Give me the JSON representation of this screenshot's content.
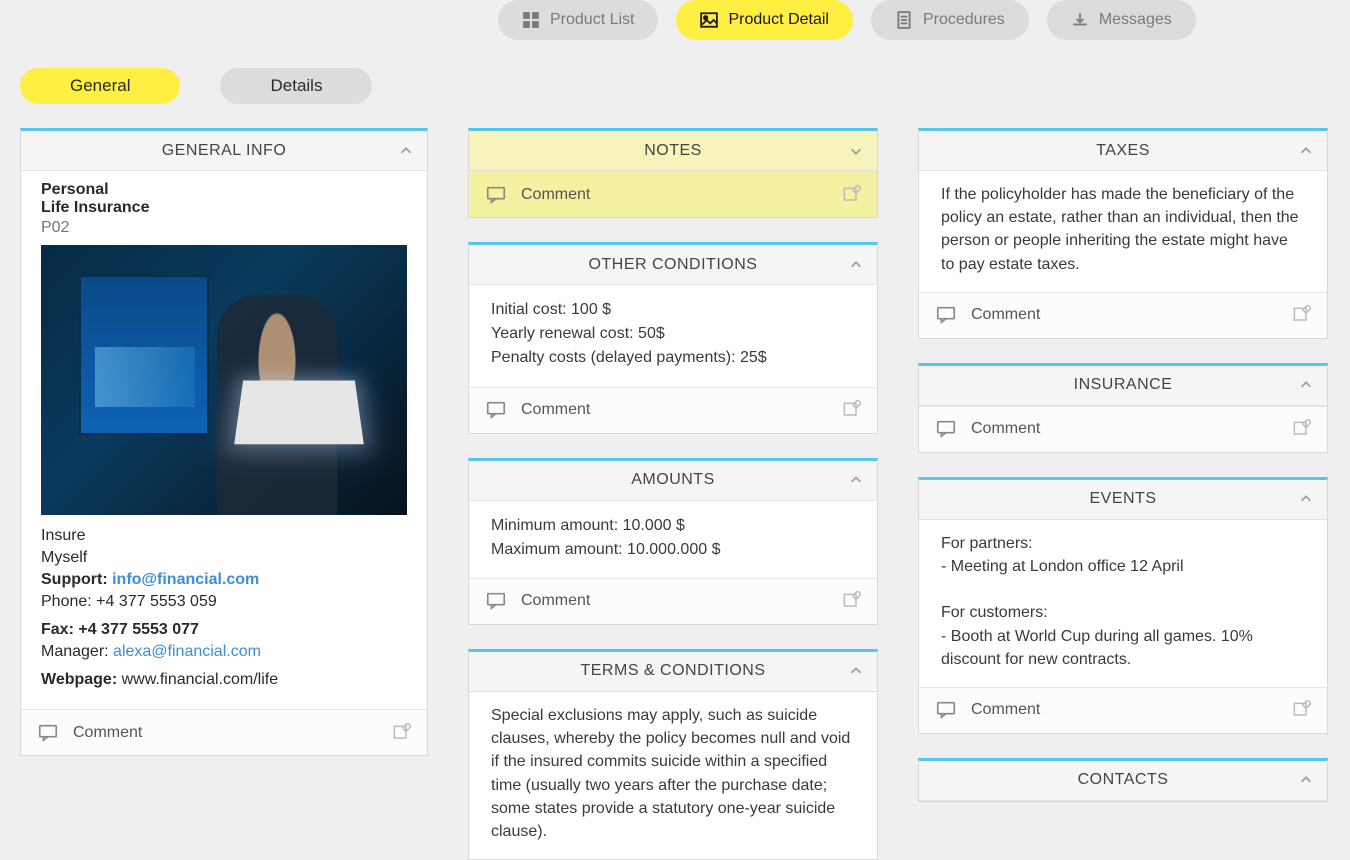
{
  "top_tabs": [
    {
      "id": "product-list",
      "label": "Product List",
      "icon": "grid",
      "active": false
    },
    {
      "id": "product-detail",
      "label": "Product Detail",
      "icon": "image",
      "active": true
    },
    {
      "id": "procedures",
      "label": "Procedures",
      "icon": "document",
      "active": false
    },
    {
      "id": "messages",
      "label": "Messages",
      "icon": "download",
      "active": false
    }
  ],
  "sub_tabs": [
    {
      "id": "general",
      "label": "General",
      "active": true
    },
    {
      "id": "details",
      "label": "Details",
      "active": false
    }
  ],
  "labels": {
    "comment": "Comment",
    "support": "Support:",
    "phone": "Phone:",
    "fax": "Fax:",
    "manager": "Manager:",
    "webpage": "Webpage:"
  },
  "general_info": {
    "title": "GENERAL INFO",
    "line1": "Personal",
    "line2": "Life Insurance",
    "code": "P02",
    "insure_line1": "Insure",
    "insure_line2": "Myself",
    "support_email": "info@financial.com",
    "phone": "+4 377 5553 059",
    "fax": "+4 377 5553 077",
    "manager_email": "alexa@financial.com",
    "webpage": "www.financial.com/life"
  },
  "notes": {
    "title": "NOTES"
  },
  "other_conditions": {
    "title": "OTHER CONDITIONS",
    "lines": [
      "Initial cost: 100 $",
      "Yearly renewal cost: 50$",
      "Penalty costs (delayed payments): 25$"
    ]
  },
  "amounts": {
    "title": "AMOUNTS",
    "lines": [
      "Minimum amount: 10.000 $",
      "Maximum amount: 10.000.000 $"
    ]
  },
  "terms": {
    "title": "TERMS & CONDITIONS",
    "text": "Special exclusions may apply, such as suicide clauses, whereby the policy becomes null and void if the insured commits suicide within a specified time (usually two years after the purchase date; some states provide a statutory one-year suicide clause)."
  },
  "taxes": {
    "title": "TAXES",
    "text": "If the policyholder has made the beneficiary of the policy an estate, rather than an individual, then the person or people inheriting the estate might have to pay estate taxes."
  },
  "insurance": {
    "title": "INSURANCE"
  },
  "events": {
    "title": "EVENTS",
    "text": "For partners:\n- Meeting at London office 12 April\n\nFor customers:\n- Booth at World Cup during all games. 10% discount for new contracts."
  },
  "contacts": {
    "title": "CONTACTS"
  }
}
